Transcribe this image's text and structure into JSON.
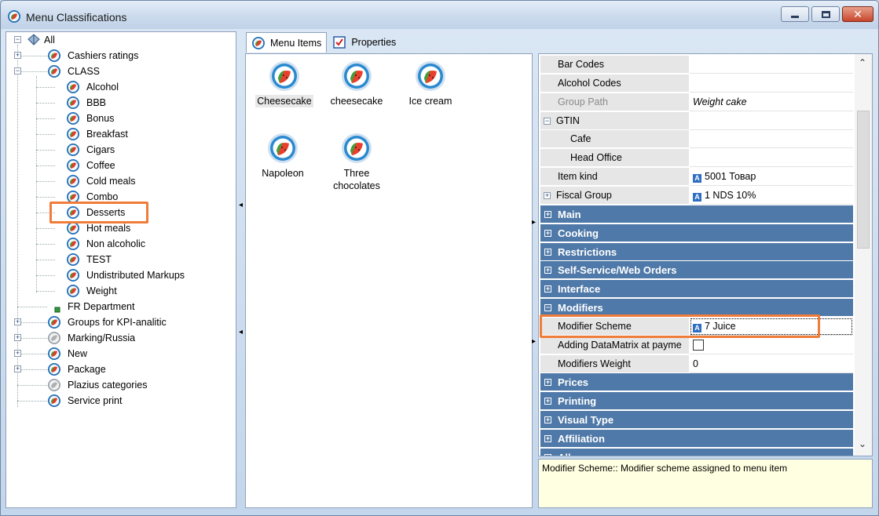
{
  "window": {
    "title": "Menu Classifications",
    "controls": {
      "minimize": "minimize",
      "maximize": "maximize",
      "close": "close"
    }
  },
  "tree": {
    "root": {
      "label": "All"
    },
    "nodes": [
      {
        "label": "Cashiers ratings",
        "level": 1,
        "expander": "+"
      },
      {
        "label": "CLASS",
        "level": 1,
        "expander": "-"
      },
      {
        "label": "Alcohol",
        "level": 2
      },
      {
        "label": "BBB",
        "level": 2
      },
      {
        "label": "Bonus",
        "level": 2
      },
      {
        "label": "Breakfast",
        "level": 2
      },
      {
        "label": "Cigars",
        "level": 2
      },
      {
        "label": "Coffee",
        "level": 2
      },
      {
        "label": "Cold meals",
        "level": 2
      },
      {
        "label": "Combo",
        "level": 2
      },
      {
        "label": "Desserts",
        "level": 2,
        "selected": true
      },
      {
        "label": "Hot meals",
        "level": 2
      },
      {
        "label": "Non alcoholic",
        "level": 2
      },
      {
        "label": "TEST",
        "level": 2
      },
      {
        "label": "Undistributed Markups",
        "level": 2
      },
      {
        "label": "Weight",
        "level": 2
      },
      {
        "label": "FR Department",
        "level": 1,
        "small_icon": true
      },
      {
        "label": "Groups for KPI-analitic",
        "level": 1,
        "expander": "+"
      },
      {
        "label": "Marking/Russia",
        "level": 1,
        "expander": "+",
        "gray_icon": true
      },
      {
        "label": "New",
        "level": 1,
        "expander": "+"
      },
      {
        "label": "Package",
        "level": 1,
        "expander": "+"
      },
      {
        "label": "Plazius categories",
        "level": 1,
        "gray_icon": true
      },
      {
        "label": "Service print",
        "level": 1
      }
    ]
  },
  "tabs": [
    {
      "label": "Menu Items",
      "active": true
    },
    {
      "label": "Properties",
      "active": false
    }
  ],
  "menu_items": [
    {
      "label": "Cheesecake",
      "selected": true
    },
    {
      "label": "cheesecake"
    },
    {
      "label": "Ice cream"
    },
    {
      "label": "Napoleon"
    },
    {
      "label": "Three chocolates",
      "label_line1": "Three",
      "label_line2": "chocolates"
    }
  ],
  "properties": {
    "rows": [
      {
        "kind": "prop",
        "name": "Bar Codes",
        "value": ""
      },
      {
        "kind": "prop",
        "name": "Alcohol Codes",
        "value": ""
      },
      {
        "kind": "prop",
        "name": "Group Path",
        "value": "Weight cake",
        "disabled": true,
        "italic": true
      },
      {
        "kind": "group",
        "name": "GTIN",
        "toggle": "-",
        "value": ""
      },
      {
        "kind": "sub",
        "name": "Cafe",
        "value": ""
      },
      {
        "kind": "sub",
        "name": "Head Office",
        "value": ""
      },
      {
        "kind": "prop",
        "name": "Item kind",
        "value": "5001 Товар",
        "badge": "A"
      },
      {
        "kind": "group",
        "name": "Fiscal Group",
        "toggle": "+",
        "value": "1 NDS 10%",
        "badge": "A"
      },
      {
        "kind": "cat",
        "name": "Main",
        "toggle": "+"
      },
      {
        "kind": "cat",
        "name": "Cooking",
        "toggle": "+"
      },
      {
        "kind": "cat",
        "name": "Restrictions",
        "toggle": "+"
      },
      {
        "kind": "cat",
        "name": "Self-Service/Web Orders",
        "toggle": "+"
      },
      {
        "kind": "cat",
        "name": "Interface",
        "toggle": "+"
      },
      {
        "kind": "cat",
        "name": "Modifiers",
        "toggle": "-"
      },
      {
        "kind": "prop",
        "name": "Modifier Scheme",
        "value": "7 Juice",
        "badge": "A",
        "focused": true
      },
      {
        "kind": "prop",
        "name": "Adding DataMatrix at payme",
        "value": "",
        "checkbox": true
      },
      {
        "kind": "prop",
        "name": "Modifiers Weight",
        "value": "0"
      },
      {
        "kind": "cat",
        "name": "Prices",
        "toggle": "+"
      },
      {
        "kind": "cat",
        "name": "Printing",
        "toggle": "+"
      },
      {
        "kind": "cat",
        "name": "Visual Type",
        "toggle": "+"
      },
      {
        "kind": "cat",
        "name": "Affiliation",
        "toggle": "+"
      },
      {
        "kind": "cat",
        "name": "All",
        "toggle": "+"
      }
    ],
    "description": "Modifier Scheme:: Modifier scheme assigned to menu item"
  },
  "colors": {
    "category_band": "#4f79a8",
    "highlight": "#f07c3a",
    "description_bg": "#ffffe1"
  }
}
